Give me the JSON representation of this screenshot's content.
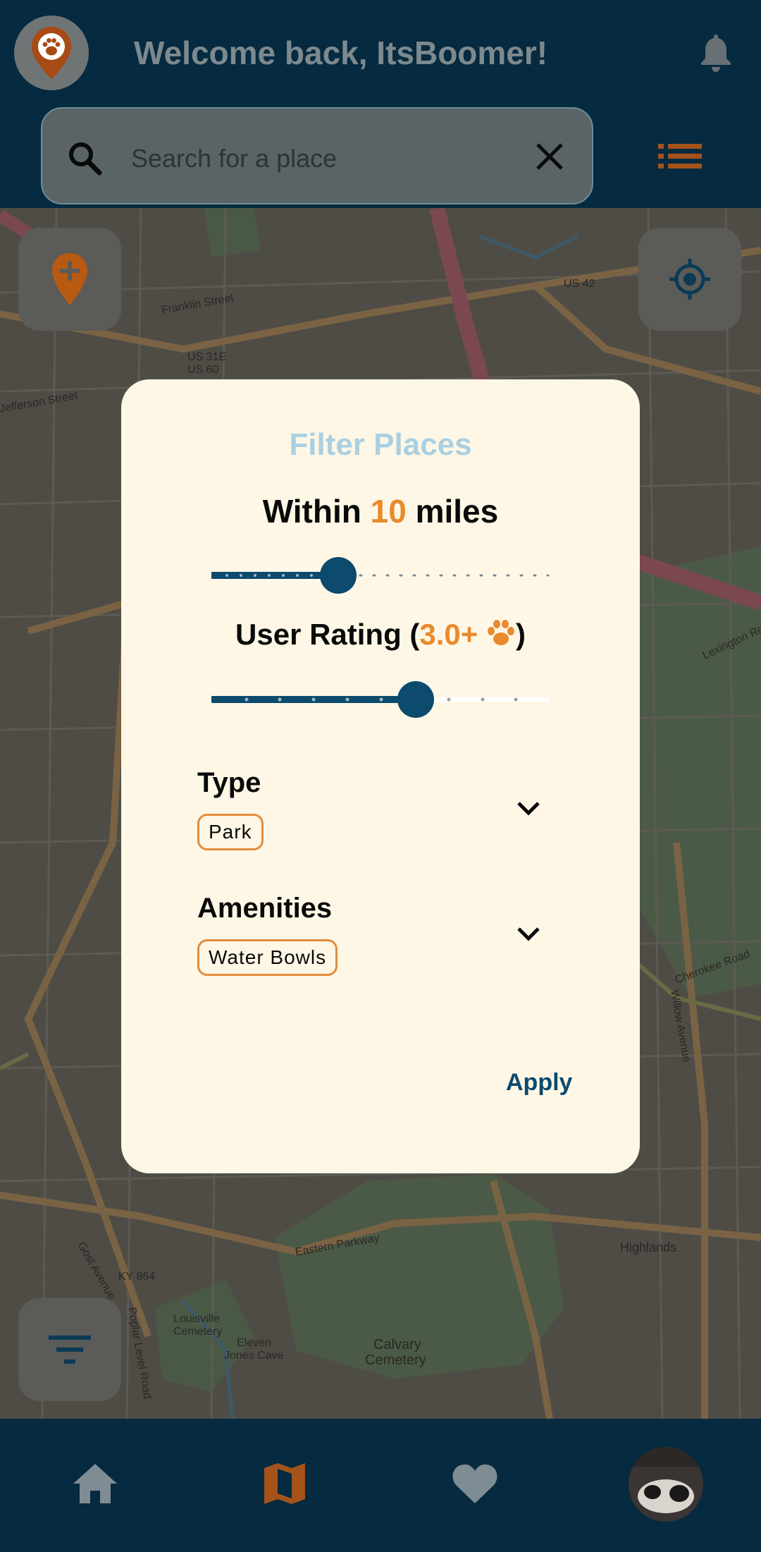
{
  "header": {
    "welcome": "Welcome back, ItsBoomer!",
    "logo_icon": "paw-pin-logo",
    "notification_icon": "bell-icon"
  },
  "search": {
    "placeholder": "Search for a place",
    "search_icon": "search-icon",
    "clear_icon": "close-icon"
  },
  "list_view_icon": "list-icon",
  "map": {
    "add_place_icon": "add-location-icon",
    "locate_icon": "my-location-icon",
    "filter_icon": "filter-icon",
    "labels": [
      "US 31E",
      "US 60",
      "US 42",
      "Eastern Parkway",
      "KY 864",
      "Calvary Cemetery",
      "Louisville Cemetery",
      "Eleven Jones Cave",
      "Cherokee Road",
      "Lexington Road",
      "Highlands",
      "Jefferson Street",
      "Franklin Street",
      "Gost Avenue",
      "Willow Avenue",
      "Poplar Level Road"
    ]
  },
  "filter_modal": {
    "title": "Filter Places",
    "distance_prefix": "Within ",
    "distance_value": "10",
    "distance_suffix": " miles",
    "distance_slider_fraction": 0.38,
    "rating_prefix": "User Rating (",
    "rating_value": "3.0+",
    "rating_suffix": ")",
    "rating_icon": "paw-icon",
    "rating_slider_fraction": 0.6,
    "type_label": "Type",
    "type_chips": [
      "Park"
    ],
    "amenities_label": "Amenities",
    "amenities_chips": [
      "Water Bowls"
    ],
    "apply_label": "Apply"
  },
  "bottom_nav": {
    "items": [
      "home-icon",
      "map-icon",
      "heart-icon",
      "profile-avatar"
    ],
    "active": "map-icon"
  },
  "colors": {
    "navy": "#062a3f",
    "accent_orange": "#e98a2c",
    "slider_blue": "#0c4a6e",
    "modal_bg": "#fff7e6",
    "title_blue": "#a9d0e2"
  }
}
